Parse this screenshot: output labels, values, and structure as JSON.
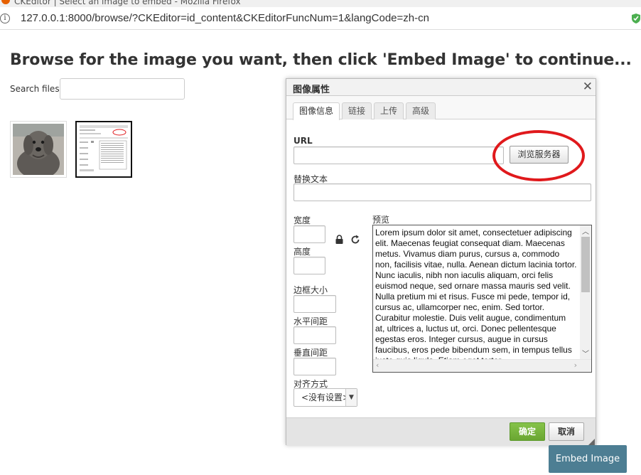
{
  "browser": {
    "title_fragment": "CKEditor | Select an image to embed - Mozilla Firefox",
    "url": "127.0.0.1:8000/browse/?CKEditor=id_content&CKEditorFuncNum=1&langCode=zh-cn"
  },
  "page": {
    "heading": "Browse for the image you want, then click 'Embed Image' to continue...",
    "search_label": "Search files:",
    "search_value": "",
    "embed_button": "Embed Image"
  },
  "dialog": {
    "title": "图像属性",
    "tabs": [
      {
        "label": "图像信息",
        "active": true
      },
      {
        "label": "链接",
        "active": false
      },
      {
        "label": "上传",
        "active": false
      },
      {
        "label": "高级",
        "active": false
      }
    ],
    "url_label": "URL",
    "url_value": "",
    "browse_server_button": "浏览服务器",
    "alt_label": "替换文本",
    "alt_value": "",
    "width_label": "宽度",
    "height_label": "高度",
    "border_label": "边框大小",
    "hspace_label": "水平间距",
    "vspace_label": "垂直间距",
    "align_label": "对齐方式",
    "align_value": "<没有设置>",
    "preview_label": "预览",
    "preview_text": "Lorem ipsum dolor sit amet, consectetuer adipiscing elit. Maecenas feugiat consequat diam. Maecenas metus. Vivamus diam purus, cursus a, commodo non, facilisis vitae, nulla. Aenean dictum lacinia tortor. Nunc iaculis, nibh non iaculis aliquam, orci felis euismod neque, sed ornare massa mauris sed velit. Nulla pretium mi et risus. Fusce mi pede, tempor id, cursus ac, ullamcorper nec, enim. Sed tortor. Curabitur molestie. Duis velit augue, condimentum at, ultrices a, luctus ut, orci. Donec pellentesque egestas eros. Integer cursus, augue in cursus faucibus, eros pede bibendum sem, in tempus tellus justo quis ligula. Etiam eget tortor.",
    "ok_button": "确定",
    "cancel_button": "取消"
  },
  "colors": {
    "embed_button_bg": "#4d7e93",
    "ok_button_bg": "#7cb342",
    "annotation_circle": "#e0191c"
  }
}
